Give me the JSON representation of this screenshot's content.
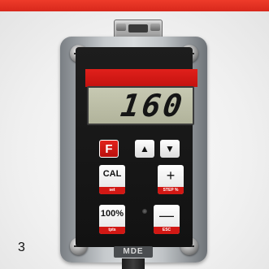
{
  "figure": {
    "number": "3"
  },
  "device": {
    "display_value": "160",
    "brand": "MDE",
    "keys": {
      "f": "F",
      "up": "▲",
      "down": "▼",
      "cal": {
        "main": "CAL",
        "sub": "set"
      },
      "plus": {
        "main": "+",
        "sub": "STEP %"
      },
      "hundred": {
        "main": "100%",
        "sub": "tpts"
      },
      "minus": {
        "main": "—",
        "sub": "ESC"
      }
    }
  },
  "colors": {
    "accent_red": "#e0201b",
    "panel": "#1a1a1a",
    "lcd": "#bfc1a8"
  }
}
